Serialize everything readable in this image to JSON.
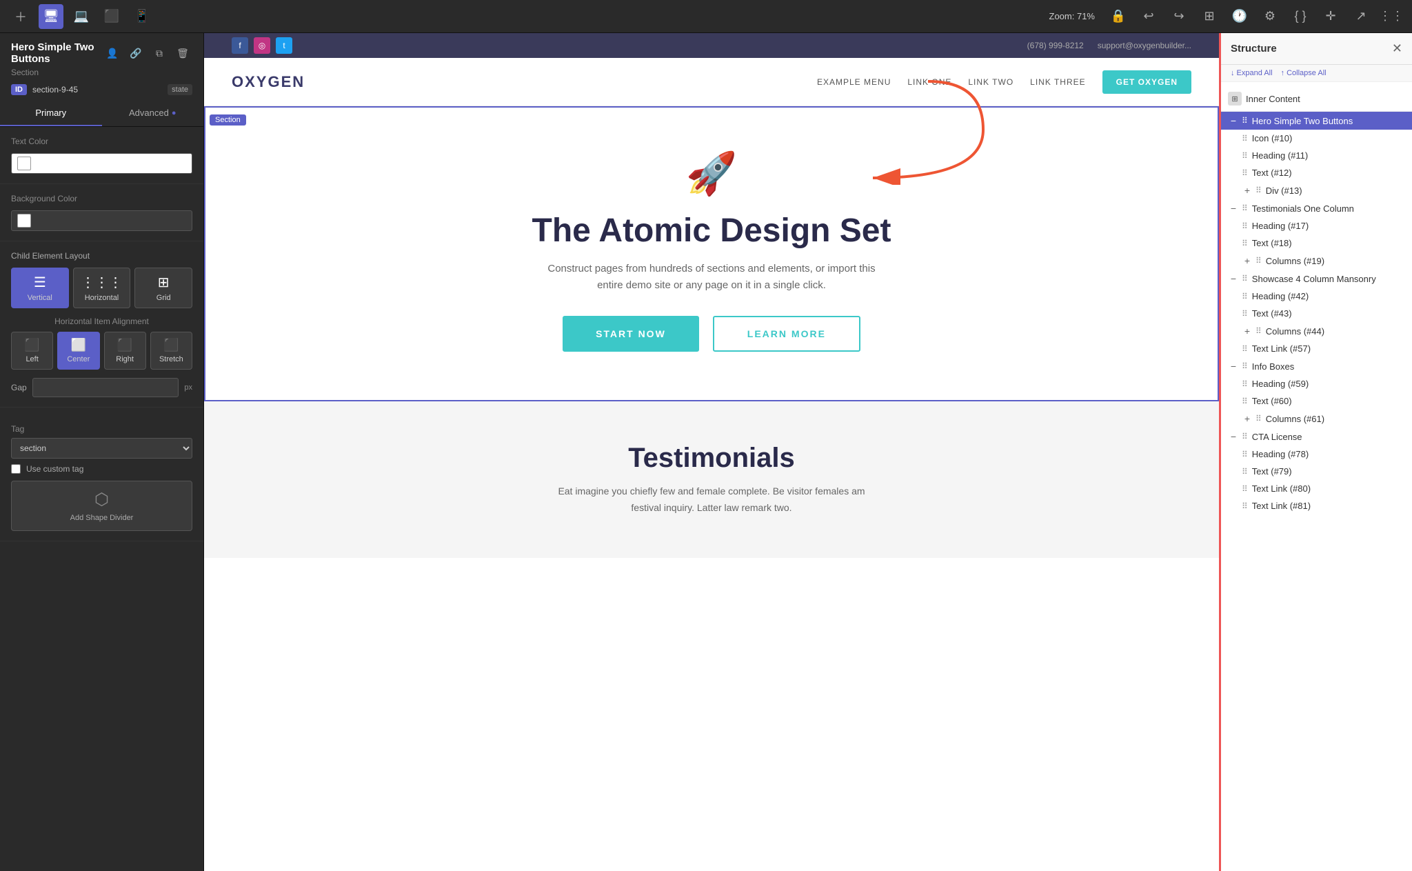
{
  "toolbar": {
    "zoom": "Zoom: 71%",
    "icons": [
      "add-icon",
      "desktop-icon",
      "laptop-icon",
      "tablet-icon",
      "mobile-icon"
    ],
    "right_icons": [
      "layout-icon",
      "history-icon",
      "settings-icon",
      "code-icon",
      "plus-icon",
      "export-icon",
      "grid-icon"
    ]
  },
  "left_panel": {
    "title": "Hero Simple Two Buttons",
    "subtitle": "Section",
    "id_badge": "ID",
    "id_value": "section-9-45",
    "state_label": "state",
    "tabs": [
      {
        "label": "Primary",
        "active": true
      },
      {
        "label": "Advanced",
        "active": false,
        "indicator": true
      }
    ],
    "text_color_label": "Text Color",
    "bg_color_label": "Background Color",
    "child_layout_label": "Child Element Layout",
    "layout_options": [
      {
        "label": "Vertical",
        "active": true
      },
      {
        "label": "Horizontal",
        "active": false
      },
      {
        "label": "Grid",
        "active": false
      }
    ],
    "alignment_label": "Horizontal Item Alignment",
    "alignment_options": [
      {
        "label": "Left",
        "active": false
      },
      {
        "label": "Center",
        "active": true
      },
      {
        "label": "Right",
        "active": false
      },
      {
        "label": "Stretch",
        "active": false
      }
    ],
    "gap_label": "Gap",
    "gap_unit": "px",
    "tag_label": "Tag",
    "tag_value": "section",
    "custom_tag_label": "Use custom tag",
    "shape_divider_label": "Add Shape Divider"
  },
  "canvas": {
    "section_badge": "Section",
    "topbar": {
      "phone": "(678) 999-8212",
      "email": "support@oxygenbuilder..."
    },
    "nav": {
      "logo": "OXYGEN",
      "links": [
        "EXAMPLE MENU",
        "LINK ONE",
        "LINK TWO",
        "LINK THREE"
      ],
      "cta": "GET OXYGEN"
    },
    "hero": {
      "title": "The Atomic Design Set",
      "text": "Construct pages from hundreds of sections and elements, or import this entire demo site or any page on it in a single click.",
      "btn1": "START NOW",
      "btn2": "LEARN MORE"
    },
    "testimonials": {
      "title": "Testimonials",
      "text": "Eat imagine you chiefly few and female complete. Be visitor females am festival inquiry. Latter law remark two."
    }
  },
  "structure": {
    "title": "Structure",
    "expand_all": "↓ Expand All",
    "collapse_all": "↑ Collapse All",
    "inner_content": "Inner Content",
    "items": [
      {
        "label": "Hero Simple Two Buttons",
        "level": 0,
        "selected": true,
        "toggle": "minus"
      },
      {
        "label": "Icon (#10)",
        "level": 1,
        "selected": false
      },
      {
        "label": "Heading (#11)",
        "level": 1,
        "selected": false
      },
      {
        "label": "Text (#12)",
        "level": 1,
        "selected": false
      },
      {
        "label": "Div (#13)",
        "level": 1,
        "selected": false,
        "toggle": "plus"
      },
      {
        "label": "Testimonials One Column",
        "level": 0,
        "selected": false,
        "toggle": "minus"
      },
      {
        "label": "Heading (#17)",
        "level": 1,
        "selected": false
      },
      {
        "label": "Text (#18)",
        "level": 1,
        "selected": false
      },
      {
        "label": "Columns (#19)",
        "level": 1,
        "selected": false,
        "toggle": "plus"
      },
      {
        "label": "Showcase 4 Column Mansonry",
        "level": 0,
        "selected": false,
        "toggle": "minus"
      },
      {
        "label": "Heading (#42)",
        "level": 1,
        "selected": false
      },
      {
        "label": "Text (#43)",
        "level": 1,
        "selected": false
      },
      {
        "label": "Columns (#44)",
        "level": 1,
        "selected": false,
        "toggle": "plus"
      },
      {
        "label": "Text Link (#57)",
        "level": 1,
        "selected": false
      },
      {
        "label": "Info Boxes",
        "level": 0,
        "selected": false,
        "toggle": "minus"
      },
      {
        "label": "Heading (#59)",
        "level": 1,
        "selected": false
      },
      {
        "label": "Text (#60)",
        "level": 1,
        "selected": false
      },
      {
        "label": "Columns (#61)",
        "level": 1,
        "selected": false,
        "toggle": "plus"
      },
      {
        "label": "CTA License",
        "level": 0,
        "selected": false,
        "toggle": "minus"
      },
      {
        "label": "Heading (#78)",
        "level": 1,
        "selected": false
      },
      {
        "label": "Text (#79)",
        "level": 1,
        "selected": false
      },
      {
        "label": "Text Link (#80)",
        "level": 1,
        "selected": false
      },
      {
        "label": "Text Link (#81)",
        "level": 1,
        "selected": false
      }
    ]
  }
}
